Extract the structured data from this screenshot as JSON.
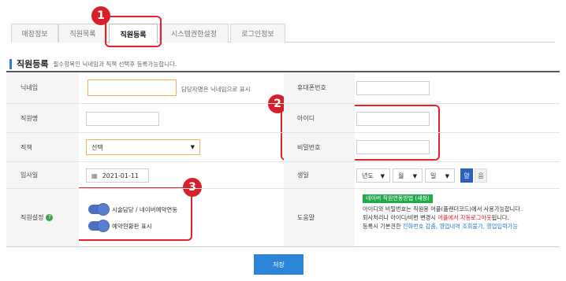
{
  "tabs": [
    {
      "label": "매장정보"
    },
    {
      "label": "직원목록"
    },
    {
      "label": "직원등록"
    },
    {
      "label": "시스템권한설정"
    },
    {
      "label": "로그인정보"
    }
  ],
  "badges": [
    "1",
    "2",
    "3"
  ],
  "section": {
    "title": "직원등록",
    "note": "필수항목인 닉네임과 직책 선택후 등록가능합니다."
  },
  "form": {
    "nickname_label": "닉네임",
    "nickname_value": "",
    "nickname_hint": "담당자명은 닉네임으로 표시",
    "phone_label": "휴대폰번호",
    "phone_value": "",
    "name_label": "직원명",
    "name_value": "",
    "id_label": "아이디",
    "id_value": "",
    "position_label": "직책",
    "position_value": "선택",
    "password_label": "비밀번호",
    "password_value": "",
    "hire_label": "입사일",
    "hire_value": "2021-01-11",
    "birth_label": "생일",
    "birth_year": "년도",
    "birth_month": "월",
    "birth_day": "일",
    "calendar_solar": "양",
    "calendar_lunar": "음",
    "staff_setting_label": "직원설정",
    "toggle1_label": "시술담당 / 네이버예약연동",
    "toggle2_label": "예약현황판 표시",
    "help_label": "도움말"
  },
  "help": {
    "tag": "네이버 직원연동방법 (새창)",
    "line1": "아이디와 비밀번호는 직원용 어플(플랜더코드)에서 사용가능합니다.",
    "line2_a": "퇴사처리나 아이디/비번 변경시 ",
    "line2_red": "어플에서 자동로그아웃",
    "line2_b": "됩니다.",
    "line3_a": "등록시 기본권한 ",
    "line3_blue": "전화번호 감춤, 영업내역 조회불가, 영업입력가능"
  },
  "save_label": "저장",
  "colors": {
    "accent": "#2b86d9",
    "highlight": "#e8202e",
    "help_tag": "#21a94a"
  }
}
